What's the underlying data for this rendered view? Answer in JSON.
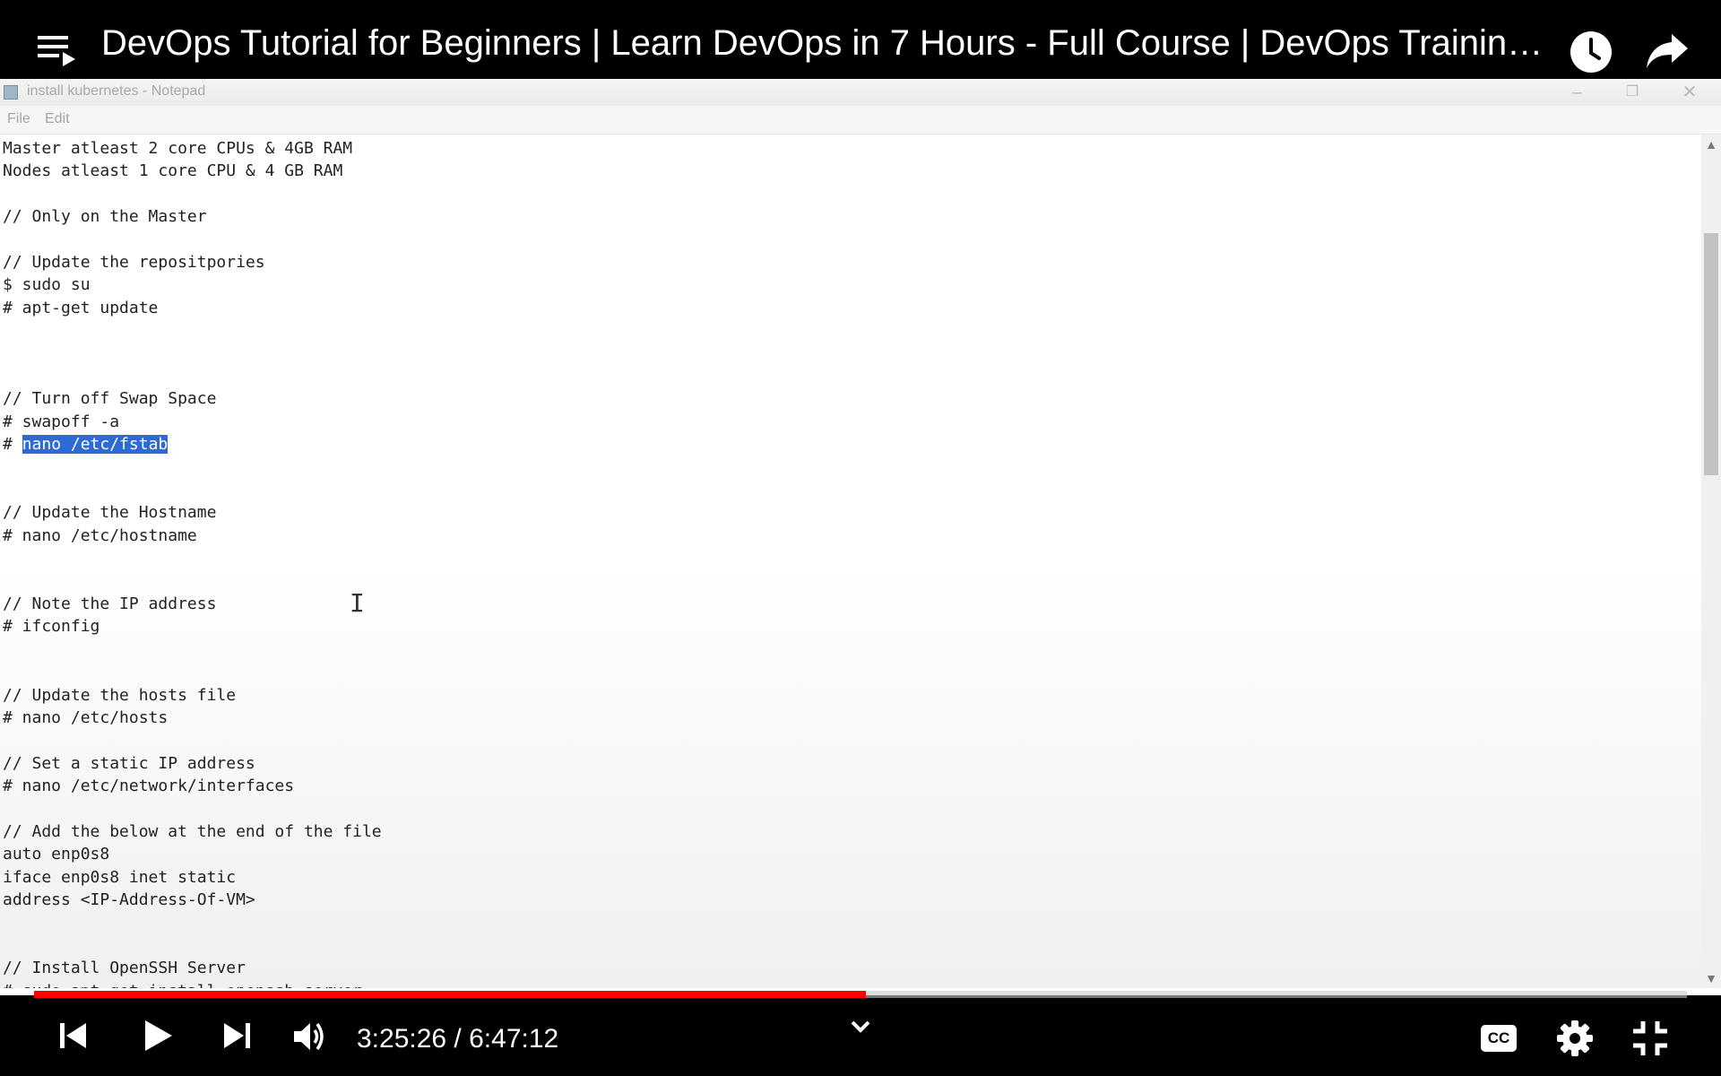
{
  "player": {
    "title": "DevOps Tutorial for Beginners | Learn DevOps in 7 Hours - Full Course | DevOps Training | Edureka",
    "current_time": "3:25:26",
    "separator": " / ",
    "duration": "6:47:12",
    "progress_fraction": 0.5033,
    "accent_color": "#ff0000",
    "icons": {
      "queue": "playlist-queue-icon",
      "watch_later": "clock-icon",
      "share": "share-arrow-icon",
      "previous": "skip-previous-icon",
      "play": "play-icon",
      "next": "skip-next-icon",
      "volume": "volume-icon",
      "chapters": "chevron-down-icon",
      "captions": "cc-icon",
      "settings": "gear-icon",
      "exit_fullscreen": "exit-fullscreen-icon"
    },
    "captions_label": "CC"
  },
  "notepad": {
    "title": "install kubernetes - Notepad",
    "menu": [
      {
        "label": "File"
      },
      {
        "label": "Edit"
      }
    ],
    "selection_color": "#2f69d5",
    "lines": [
      {
        "text": "Master atleast 2 core CPUs & 4GB RAM"
      },
      {
        "text": "Nodes atleast 1 core CPU & 4 GB RAM"
      },
      {
        "text": ""
      },
      {
        "text": "// Only on the Master"
      },
      {
        "text": ""
      },
      {
        "text": "// Update the repositpories"
      },
      {
        "text": "$ sudo su"
      },
      {
        "text": "# apt-get update"
      },
      {
        "text": ""
      },
      {
        "text": ""
      },
      {
        "text": ""
      },
      {
        "text": "// Turn off Swap Space"
      },
      {
        "text": "# swapoff -a"
      },
      {
        "text": "# ",
        "selected": "nano /etc/fstab"
      },
      {
        "text": ""
      },
      {
        "text": ""
      },
      {
        "text": "// Update the Hostname"
      },
      {
        "text": "# nano /etc/hostname"
      },
      {
        "text": ""
      },
      {
        "text": ""
      },
      {
        "text": "// Note the IP address"
      },
      {
        "text": "# ifconfig"
      },
      {
        "text": ""
      },
      {
        "text": ""
      },
      {
        "text": "// Update the hosts file"
      },
      {
        "text": "# nano /etc/hosts"
      },
      {
        "text": ""
      },
      {
        "text": "// Set a static IP address"
      },
      {
        "text": "# nano /etc/network/interfaces"
      },
      {
        "text": ""
      },
      {
        "text": "// Add the below at the end of the file"
      },
      {
        "text": "auto enp0s8"
      },
      {
        "text": "iface enp0s8 inet static"
      },
      {
        "text": "address <IP-Address-Of-VM>"
      },
      {
        "text": ""
      },
      {
        "text": ""
      },
      {
        "text": "// Install OpenSSH Server"
      },
      {
        "text": "# sudo apt-get install openssh-server"
      }
    ]
  }
}
